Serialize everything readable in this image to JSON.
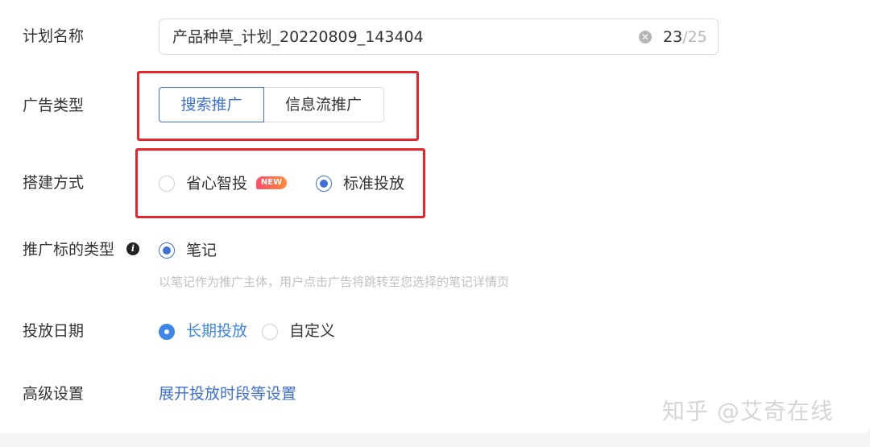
{
  "plan_name": {
    "label": "计划名称",
    "value": "产品种草_计划_20220809_143404",
    "counter_current": "23",
    "counter_separator": "/",
    "counter_max": "25"
  },
  "ad_type": {
    "label": "广告类型",
    "options": [
      "搜索推广",
      "信息流推广"
    ],
    "selected": "搜索推广"
  },
  "build_mode": {
    "label": "搭建方式",
    "options": [
      {
        "label": "省心智投",
        "badge": "NEW",
        "selected": false
      },
      {
        "label": "标准投放",
        "selected": true
      }
    ]
  },
  "promo_type": {
    "label": "推广标的类型",
    "option": "笔记",
    "hint": "以笔记作为推广主体，用户点击广告将跳转至您选择的笔记详情页"
  },
  "schedule": {
    "label": "投放日期",
    "options": [
      {
        "label": "长期投放",
        "selected": true
      },
      {
        "label": "自定义",
        "selected": false
      }
    ]
  },
  "advanced": {
    "label": "高级设置",
    "link": "展开投放时段等设置"
  },
  "watermark": "知乎 @艾奇在线",
  "colors": {
    "accent": "#3e6fd8",
    "highlight_border": "#e8242d"
  }
}
